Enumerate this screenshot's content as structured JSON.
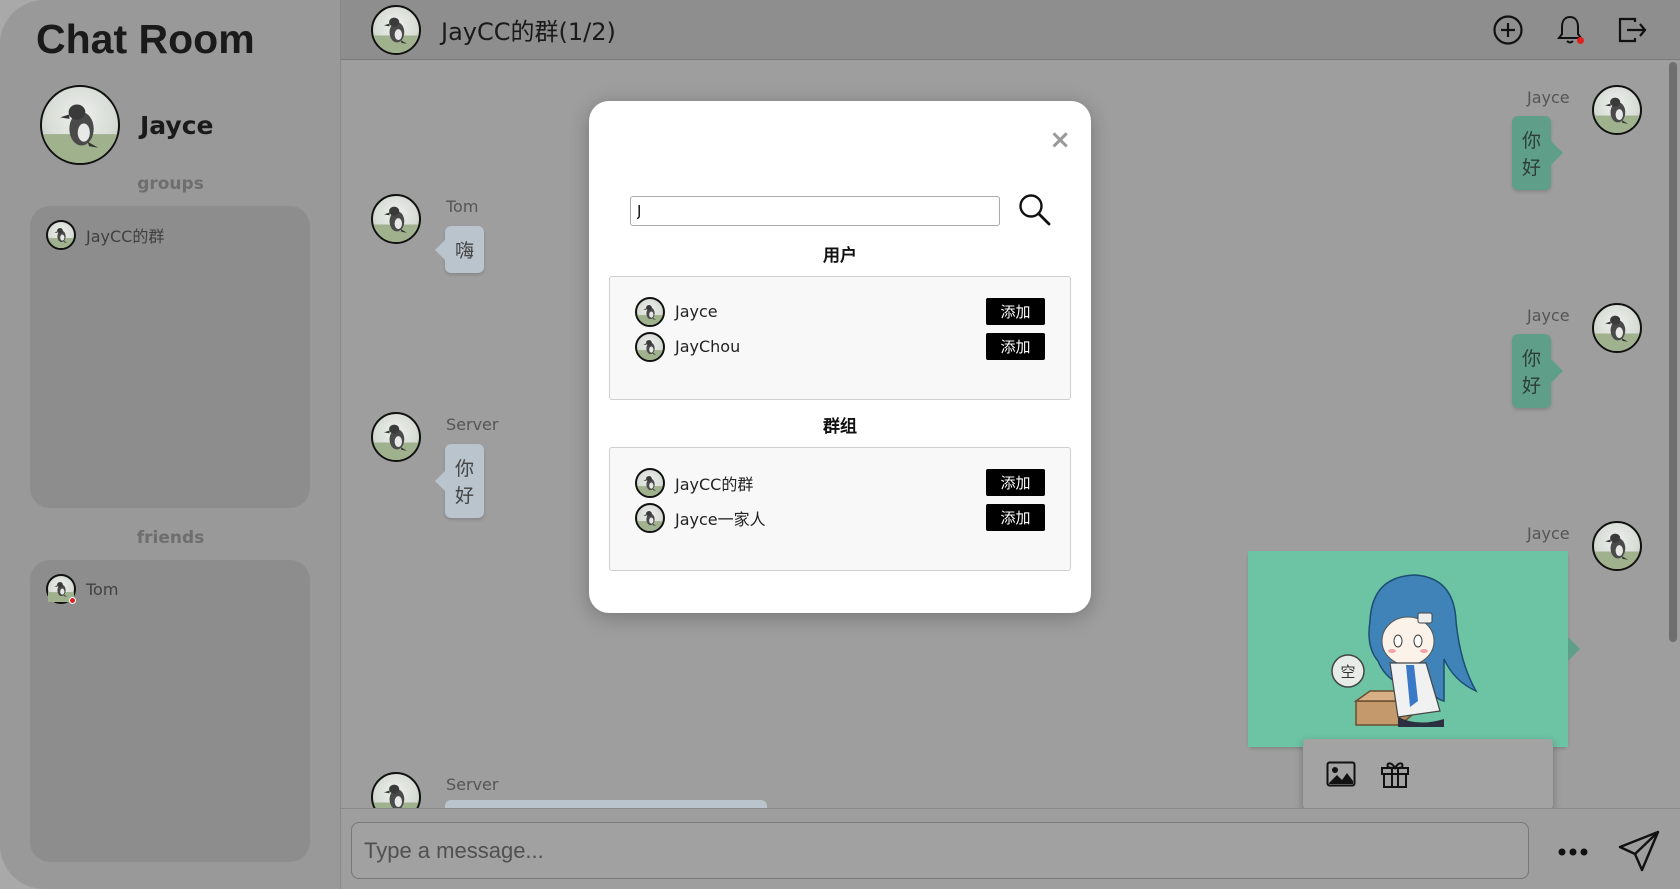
{
  "app": {
    "title": "Chat Room"
  },
  "user": {
    "name": "Jayce"
  },
  "sidebar": {
    "groups_label": "groups",
    "groups": [
      {
        "name": "JayCC的群"
      }
    ],
    "friends_label": "friends",
    "friends": [
      {
        "name": "Tom",
        "online": true
      }
    ]
  },
  "header": {
    "title": "JayCC的群(1/2)"
  },
  "messages": [
    {
      "sender": "Jayce",
      "text": "你好",
      "side": "right"
    },
    {
      "sender": "Tom",
      "text": "嗨",
      "side": "left"
    },
    {
      "sender": "Jayce",
      "text": "你好",
      "side": "right"
    },
    {
      "sender": "Server",
      "text": "你好",
      "side": "left"
    },
    {
      "sender": "Jayce",
      "text": "空",
      "side": "right",
      "kind": "sticker"
    },
    {
      "sender": "Server",
      "text": "",
      "side": "left"
    }
  ],
  "composer": {
    "placeholder": "Type a message..."
  },
  "modal": {
    "search_value": "J",
    "users_heading": "用户",
    "users": [
      {
        "name": "Jayce",
        "action": "添加"
      },
      {
        "name": "JayChou",
        "action": "添加"
      }
    ],
    "groups_heading": "群组",
    "groups": [
      {
        "name": "JayCC的群",
        "action": "添加"
      },
      {
        "name": "Jayce一家人",
        "action": "添加"
      }
    ],
    "close_label": "×"
  },
  "colors": {
    "sent_bubble": "#5f9f8a",
    "received_bubble": "#b9c4cc",
    "overlay_dim": "#999999",
    "add_button": "#000000"
  }
}
